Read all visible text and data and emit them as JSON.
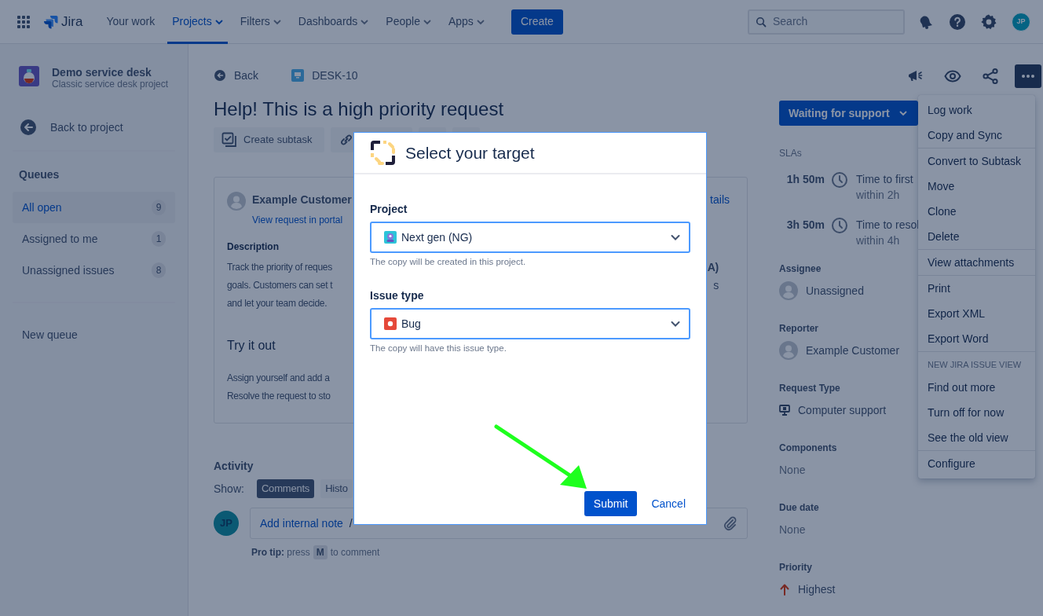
{
  "top_nav": {
    "product": "Jira",
    "items": [
      {
        "label": "Your work",
        "selected": false,
        "dropdown": false
      },
      {
        "label": "Projects",
        "selected": true,
        "dropdown": true
      },
      {
        "label": "Filters",
        "selected": false,
        "dropdown": true
      },
      {
        "label": "Dashboards",
        "selected": false,
        "dropdown": true
      },
      {
        "label": "People",
        "selected": false,
        "dropdown": true
      },
      {
        "label": "Apps",
        "selected": false,
        "dropdown": true
      }
    ],
    "create_button": "Create",
    "search": {
      "placeholder": "Search"
    },
    "avatar": "JP"
  },
  "sidebar": {
    "project_name": "Demo service desk",
    "project_type": "Classic service desk project",
    "back_link": "Back to project",
    "queues_heading": "Queues",
    "queues": [
      {
        "label": "All open",
        "count": "9",
        "selected": true
      },
      {
        "label": "Assigned to me",
        "count": "1",
        "selected": false
      },
      {
        "label": "Unassigned issues",
        "count": "8",
        "selected": false
      }
    ],
    "new_queue": "New queue"
  },
  "issue": {
    "back": "Back",
    "key": "DESK-10",
    "title": "Help! This is a high priority request",
    "create_subtask": "Create subtask",
    "reporter": "Example Customer",
    "portal_link": "View request in portal",
    "details_fragment": "tails",
    "description_label": "Description",
    "description_lines": [
      {
        "text": "Track the priority of reques",
        "right": {
          "text": "A)",
          "bold": true
        }
      },
      {
        "text": "goals. Customers can set t",
        "right": {
          "text": "s",
          "bold": false
        }
      },
      {
        "text": "and let your team decide."
      }
    ],
    "section_heading": "Try it out",
    "section_lines": [
      "Assign yourself and add a",
      "Resolve the request to sto"
    ]
  },
  "activity": {
    "heading": "Activity",
    "show_label": "Show:",
    "filters": [
      {
        "label": "Comments",
        "selected": true
      },
      {
        "label": "Histo",
        "selected": false
      }
    ],
    "avatar": "JP",
    "comment_actions": [
      "Add internal note"
    ],
    "separator": "/",
    "pro_tip": "**Pro tip:** press",
    "pro_tip_key": "M",
    "pro_tip_end": "to comment"
  },
  "details": {
    "more_expanded": true,
    "status": "Waiting for support",
    "slas_heading": "SLAs",
    "slas": [
      {
        "remaining": "1h 50m",
        "name": "Time to first",
        "target": "within 2h"
      },
      {
        "remaining": "3h 50m",
        "name": "Time to resol",
        "target": "within 4h"
      }
    ],
    "fields": [
      {
        "label": "Assignee",
        "value": "Unassigned",
        "kind": "person"
      },
      {
        "label": "Reporter",
        "value": "Example Customer",
        "kind": "person"
      },
      {
        "label": "Request Type",
        "value": "Computer support",
        "kind": "request_type"
      },
      {
        "label": "Components",
        "value": "None",
        "kind": "empty"
      },
      {
        "label": "Due date",
        "value": "None",
        "kind": "empty"
      },
      {
        "label": "Priority",
        "value": "Highest",
        "kind": "priority"
      }
    ]
  },
  "more_menu": {
    "sections": [
      {
        "items": [
          "Log work",
          "Copy and Sync"
        ]
      },
      {
        "items": [
          "Convert to Subtask",
          "Move",
          "Clone",
          "Delete"
        ]
      },
      {
        "items": [
          "View attachments"
        ]
      },
      {
        "items": [
          "Print",
          "Export XML",
          "Export Word"
        ]
      },
      {
        "heading": "NEW JIRA ISSUE VIEW",
        "items": [
          "Find out more",
          "Turn off for now",
          "See the old view"
        ]
      },
      {
        "items": [
          "Configure"
        ]
      }
    ]
  },
  "dialog": {
    "title": "Select your target",
    "fields": [
      {
        "label": "Project",
        "value": "Next gen (NG)",
        "kind": "project",
        "help": "The copy will be created in this project."
      },
      {
        "label": "Issue type",
        "value": "Bug",
        "kind": "bug",
        "help": "The copy will have this issue type."
      }
    ],
    "submit": "Submit",
    "cancel": "Cancel"
  }
}
